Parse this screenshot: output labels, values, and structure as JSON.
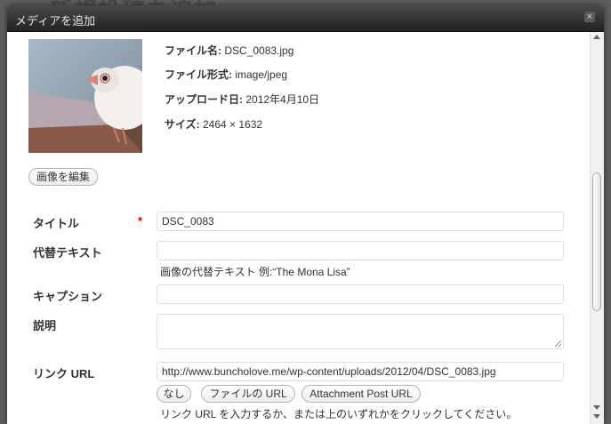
{
  "dialog": {
    "title": "メディアを追加",
    "close_symbol": "×"
  },
  "background": {
    "heading_fragment": "新規投稿を追加"
  },
  "file": {
    "name_label": "ファイル名:",
    "name_value": "DSC_0083.jpg",
    "type_label": "ファイル形式:",
    "type_value": "image/jpeg",
    "date_label": "アップロード日:",
    "date_value": "2012年4月10日",
    "size_label": "サイズ:",
    "size_value": "2464 × 1632",
    "thumbnail_icon": "bird-photo-thumbnail"
  },
  "buttons": {
    "edit_image": "画像を編集",
    "none": "なし",
    "file_url": "ファイルの URL",
    "attachment_post_url": "Attachment Post URL"
  },
  "form": {
    "title_label": "タイトル",
    "required_mark": "*",
    "title_value": "DSC_0083",
    "alt_label": "代替テキスト",
    "alt_value": "",
    "alt_help": "画像の代替テキスト 例:“The Mona Lisa”",
    "caption_label": "キャプション",
    "caption_value": "",
    "description_label": "説明",
    "description_value": "",
    "link_label": "リンク URL",
    "link_value": "http://www.buncholove.me/wp-content/uploads/2012/04/DSC_0083.jpg",
    "link_help": "リンク URL を入力するか、または上のいずれかをクリックしてください。"
  }
}
